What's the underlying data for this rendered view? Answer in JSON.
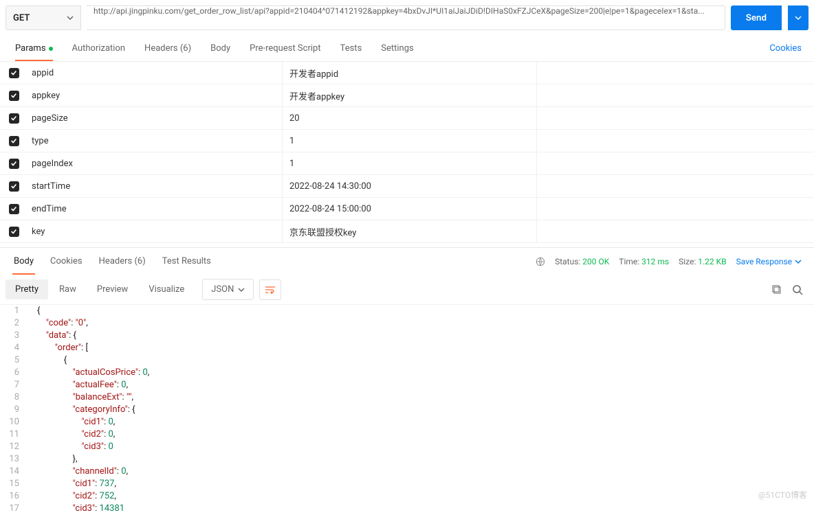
{
  "request": {
    "method": "GET",
    "url": "http://api.jingpinku.com/get_order_row_list/api?appid=210404^071412192&appkey=4bxDvJI*UI1aiJaiJDiD!DIHaS0xFZJCeX&pageSize=200|e|pe=1&pageceIex=1&sta...",
    "send_label": "Send"
  },
  "req_tabs": [
    {
      "label": "Params",
      "active": true,
      "dot": true
    },
    {
      "label": "Authorization"
    },
    {
      "label": "Headers (6)"
    },
    {
      "label": "Body"
    },
    {
      "label": "Pre-request Script"
    },
    {
      "label": "Tests"
    },
    {
      "label": "Settings"
    }
  ],
  "cookies_link": "Cookies",
  "params": [
    {
      "key": "appid",
      "value": "开发者appid"
    },
    {
      "key": "appkey",
      "value": "开发者appkey"
    },
    {
      "key": "pageSize",
      "value": "20"
    },
    {
      "key": "type",
      "value": "1"
    },
    {
      "key": "pageIndex",
      "value": "1"
    },
    {
      "key": "startTime",
      "value": "2022-08-24 14:30:00"
    },
    {
      "key": "endTime",
      "value": "2022-08-24 15:00:00"
    },
    {
      "key": "key",
      "value": "京东联盟授权key"
    }
  ],
  "resp_tabs": [
    {
      "label": "Body",
      "active": true
    },
    {
      "label": "Cookies"
    },
    {
      "label": "Headers (6)"
    },
    {
      "label": "Test Results"
    }
  ],
  "status": {
    "label": "Status:",
    "code": "200 OK"
  },
  "time": {
    "label": "Time:",
    "value": "312 ms"
  },
  "size": {
    "label": "Size:",
    "value": "1.22 KB"
  },
  "save_response": "Save Response",
  "view_buttons": [
    "Pretty",
    "Raw",
    "Preview",
    "Visualize"
  ],
  "format_label": "JSON",
  "code_lines": [
    "{",
    "    \"code\": \"0\",",
    "    \"data\": {",
    "        \"order\": [",
    "            {",
    "                \"actualCosPrice\": 0,",
    "                \"actualFee\": 0,",
    "                \"balanceExt\": \"\",",
    "                \"categoryInfo\": {",
    "                    \"cid1\": 0,",
    "                    \"cid2\": 0,",
    "                    \"cid3\": 0",
    "                },",
    "                \"channelId\": 0,",
    "                \"cid1\": 737,",
    "                \"cid2\": 752,",
    "                \"cid3\": 14381"
  ],
  "watermark": "@51CTO博客"
}
